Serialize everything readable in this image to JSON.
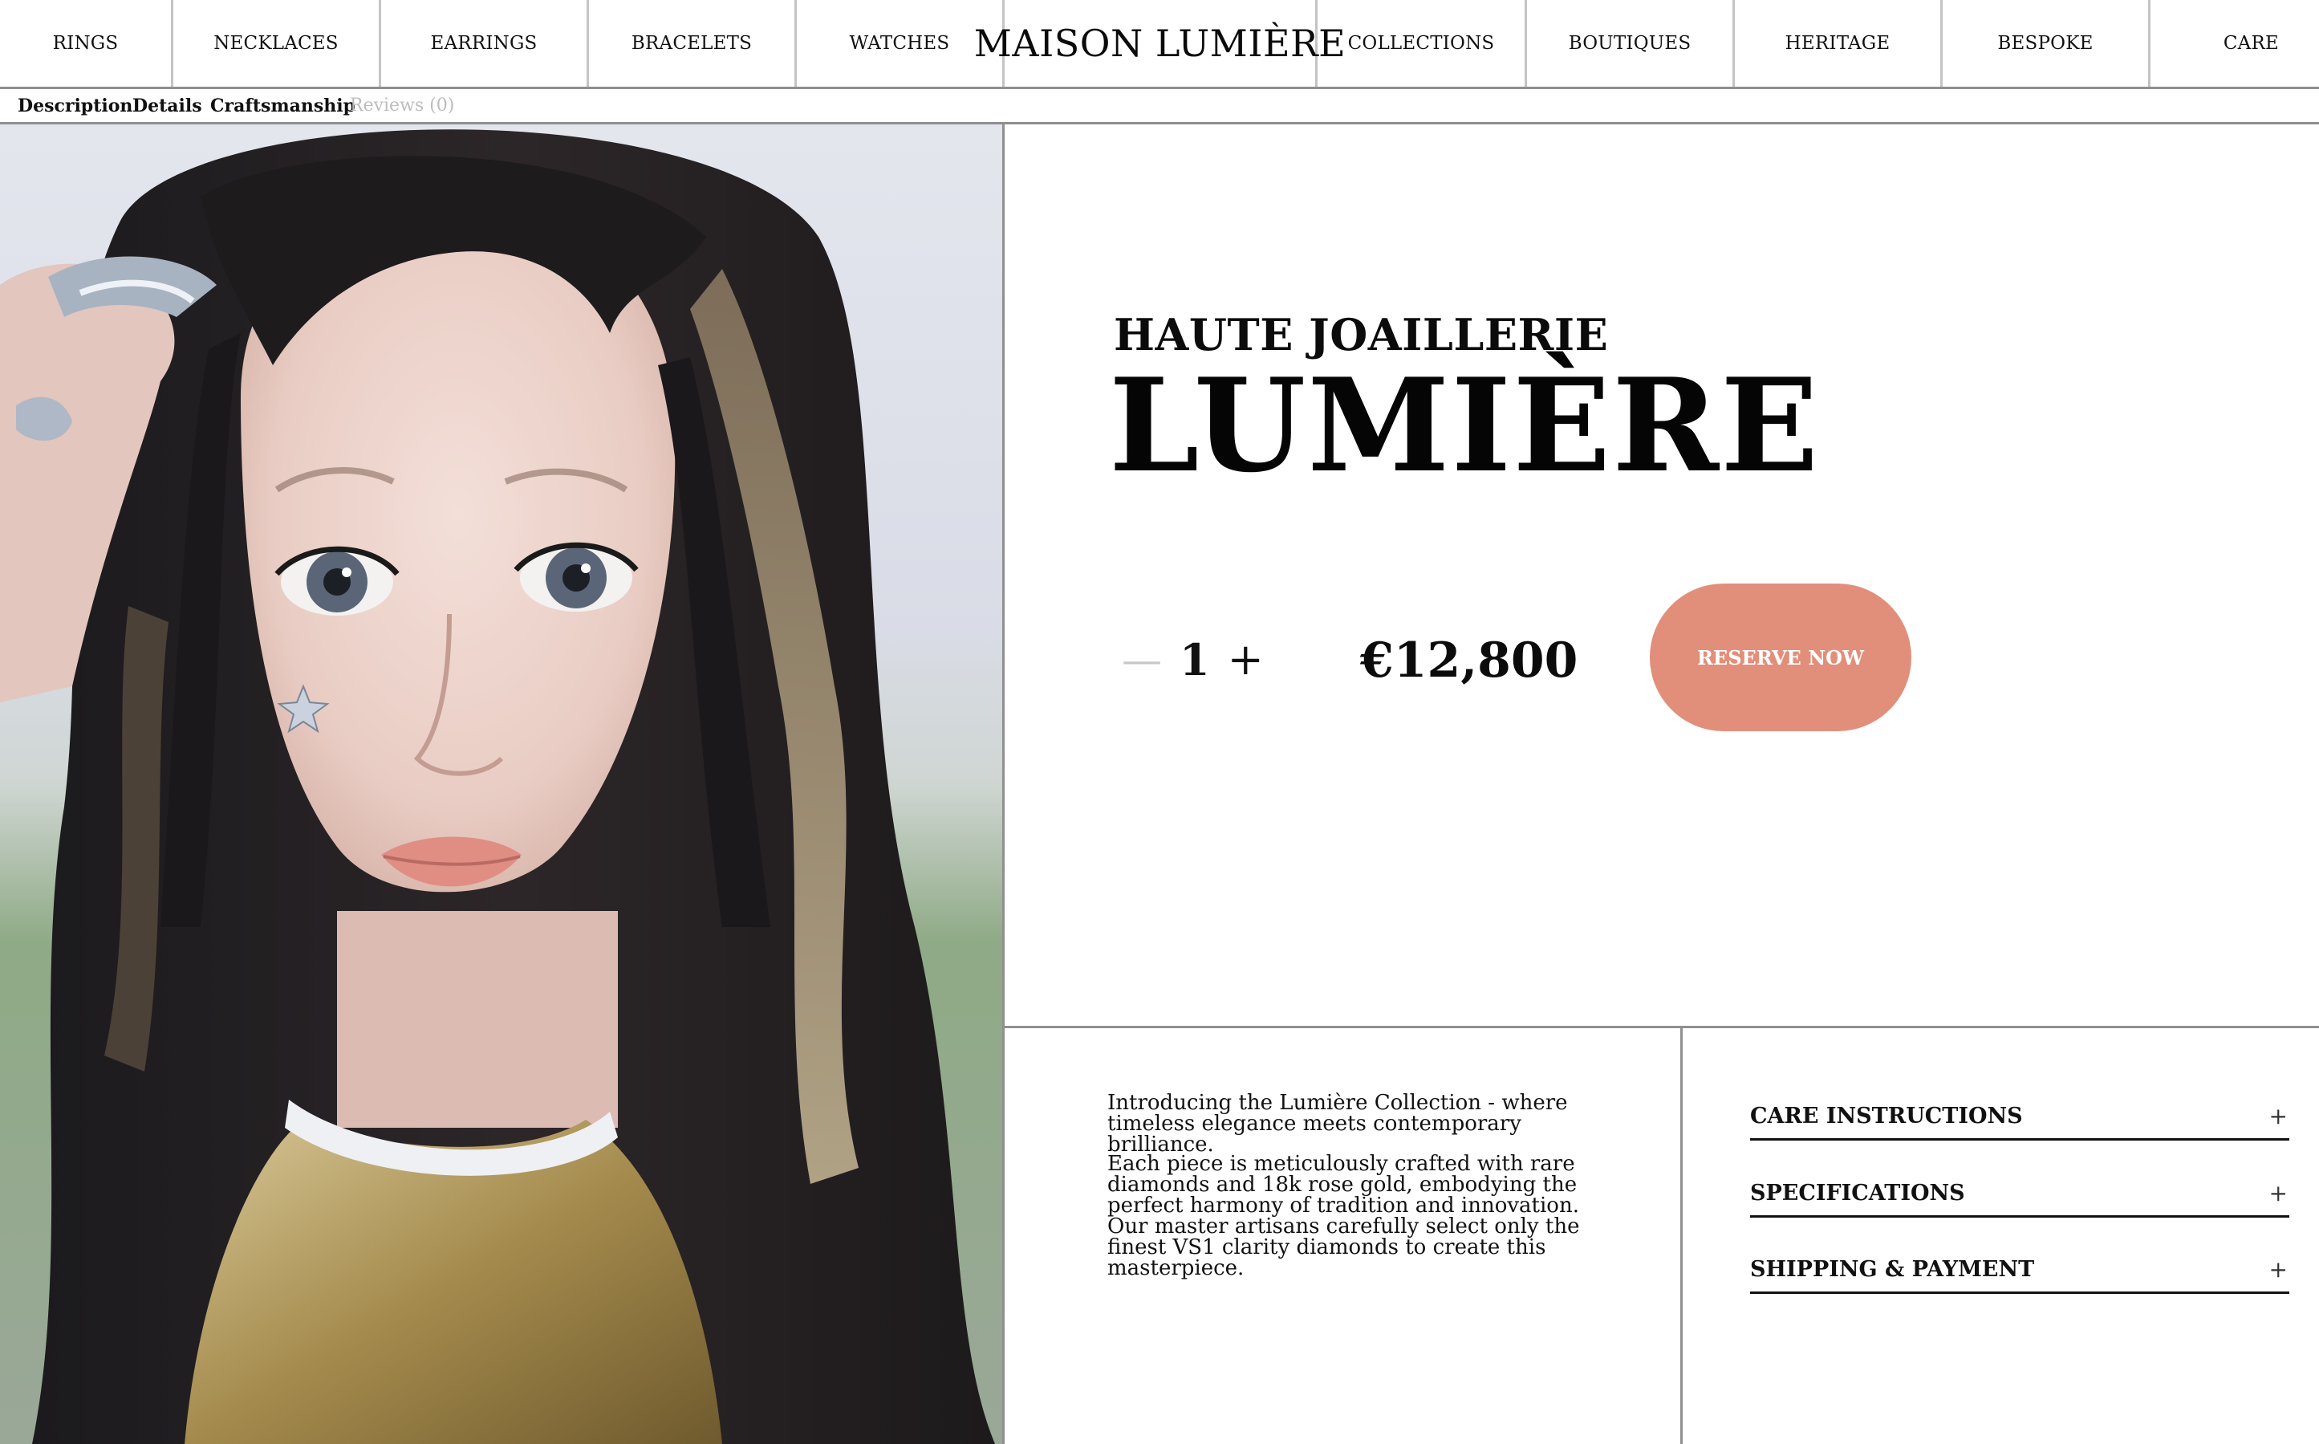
{
  "nav": {
    "left": [
      "RINGS",
      "NECKLACES",
      "EARRINGS",
      "BRACELETS",
      "WATCHES"
    ],
    "logo": "MAISON LUMIÈRE",
    "right": [
      "COLLECTIONS",
      "BOUTIQUES",
      "HERITAGE",
      "BESPOKE",
      "CARE"
    ]
  },
  "tabs": [
    "Description",
    "Details",
    "Craftsmanship",
    "Reviews (0)"
  ],
  "product": {
    "kicker": "HAUTE JOAILLERIE",
    "title": "LUMIÈRE",
    "quantity": "1",
    "minus": "—",
    "plus": "+",
    "price": "€12,800",
    "cta": "RESERVE NOW"
  },
  "description": {
    "p1": "Introducing the Lumière Collection - where timeless elegance meets contemporary brilliance.",
    "p2": "Each piece is meticulously crafted with rare diamonds and 18k rose gold, embodying the perfect harmony of tradition and innovation. Our master artisans carefully select only the finest VS1 clarity diamonds to create this masterpiece."
  },
  "accordion": [
    {
      "label": "CARE INSTRUCTIONS",
      "icon": "+"
    },
    {
      "label": "SPECIFICATIONS",
      "icon": "+"
    },
    {
      "label": "SHIPPING & PAYMENT",
      "icon": "+"
    }
  ],
  "colors": {
    "cta": "#e18f7a",
    "divider": "#8f8f8f",
    "text": "#111111"
  },
  "hero_image": "portrait-photo"
}
